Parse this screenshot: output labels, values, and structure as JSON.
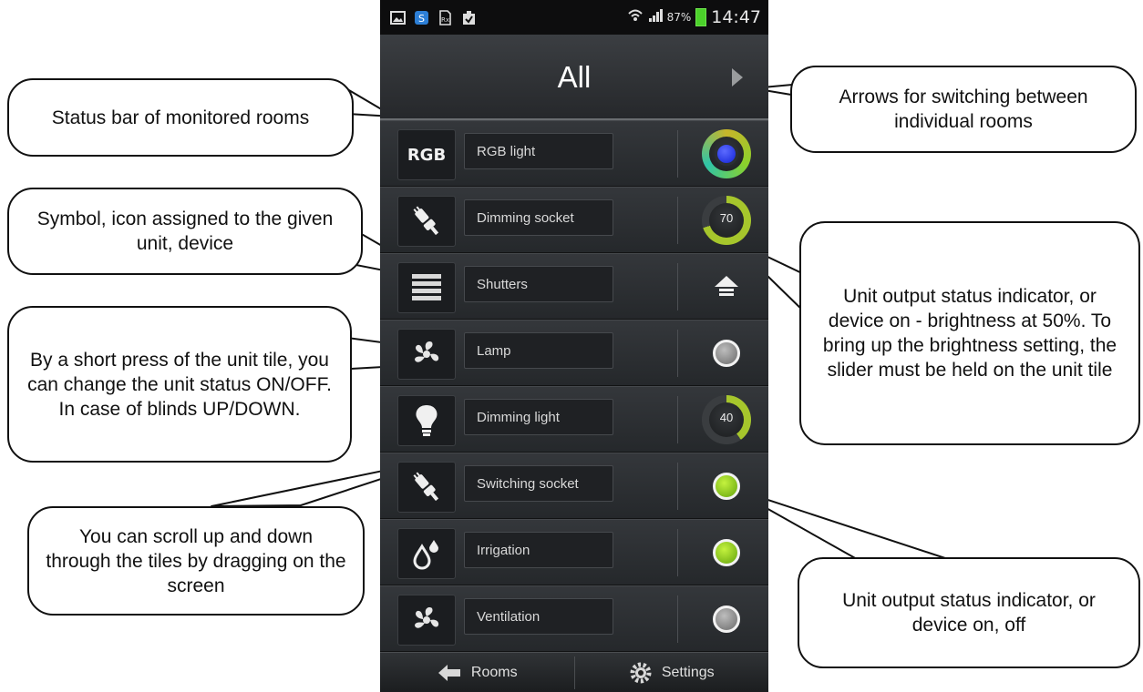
{
  "status_bar": {
    "left_icons": [
      "image-icon",
      "app-icon",
      "doc-icon",
      "clipboard-icon"
    ],
    "battery": "87%",
    "time": "14:47"
  },
  "header": {
    "title": "All"
  },
  "tiles": [
    {
      "label": "RGB light",
      "icon": "rgb-icon",
      "icon_text": "RGB",
      "indicator": "color",
      "indicator_color": "#2a3cff",
      "level": 1.0
    },
    {
      "label": "Dimming socket",
      "icon": "socket-icon",
      "indicator": "dial",
      "value": "70",
      "level": 0.7
    },
    {
      "label": "Shutters",
      "icon": "shutters-icon",
      "indicator": "shutter-up"
    },
    {
      "label": "Lamp",
      "icon": "fan-icon",
      "indicator": "off"
    },
    {
      "label": "Dimming light",
      "icon": "bulb-icon",
      "indicator": "dial",
      "value": "40",
      "level": 0.4
    },
    {
      "label": "Switching socket",
      "icon": "socket-icon",
      "indicator": "on"
    },
    {
      "label": "Irrigation",
      "icon": "water-drops-icon",
      "indicator": "on"
    },
    {
      "label": "Ventilation",
      "icon": "fan-icon",
      "indicator": "off"
    }
  ],
  "bottom_bar": {
    "rooms": "Rooms",
    "settings": "Settings"
  },
  "callouts": {
    "status_bar": "Status bar of monitored rooms",
    "arrows": "Arrows for switching between individual rooms",
    "symbol": "Symbol, icon assigned to the given unit, device",
    "short_press": "By a short press of the unit tile, you can change the unit status ON/OFF. In case of blinds UP/DOWN.",
    "scroll": "You can scroll up and down through the tiles by dragging on the screen",
    "brightness": "Unit output status indicator, or device on - brightness at 50%. To bring up the brightness setting, the slider must be held on the unit tile",
    "on_off": "Unit output status indicator, or device on, off"
  }
}
